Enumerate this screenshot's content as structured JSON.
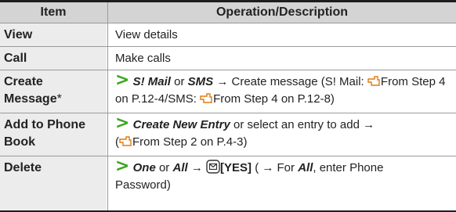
{
  "header": {
    "item": "Item",
    "operation": "Operation/Description"
  },
  "rows": [
    {
      "item": "View",
      "desc": "View details"
    },
    {
      "item": "Call",
      "desc": "Make calls"
    },
    {
      "item_line1": "Create",
      "item_line2": "Message",
      "item_mark": "*",
      "opt1": "S! Mail",
      "or": "or",
      "opt2": "SMS",
      "arrow": "→",
      "text1": "Create message (S! Mail:",
      "ref1": "From Step 4 on P.12-4/SMS:",
      "ref2": "From Step 4 on P.12-8)"
    },
    {
      "item_line1": "Add to Phone",
      "item_line2": "Book",
      "opt1": "Create New Entry",
      "text1": "or select an entry to add",
      "arrow": "→",
      "ref1": "From Step 2 on P.4-3)"
    },
    {
      "item": "Delete",
      "opt1": "One",
      "or": "or",
      "opt2": "All",
      "arrow": "→",
      "yes": "[YES]",
      "text1": "( → For",
      "opt3": "All",
      "text2": ", enter Phone",
      "text3": "Password)"
    }
  ],
  "icons": {
    "prompt": ">",
    "reference": "pointing-hand-icon",
    "mail_key": "mail-key-icon"
  },
  "colors": {
    "prompt_green": "#3aa620",
    "header_bg": "#d4d4d4",
    "key_bg": "#ececec"
  }
}
